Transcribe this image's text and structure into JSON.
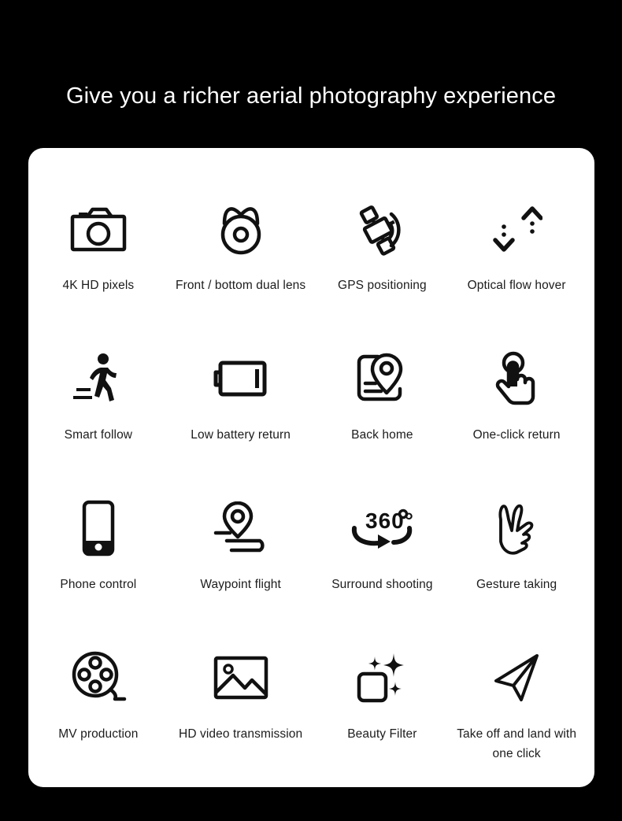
{
  "headline": "Give you a richer aerial photography experience",
  "colors": {
    "background": "#000000",
    "card": "#ffffff",
    "headline_text": "#ffffff",
    "label_text": "#1c1c1c",
    "icon_stroke": "#111111"
  },
  "features": [
    {
      "icon": "camera-icon",
      "label": "4K HD pixels"
    },
    {
      "icon": "dual-lens-icon",
      "label": "Front / bottom dual lens"
    },
    {
      "icon": "gps-satellite-icon",
      "label": "GPS positioning"
    },
    {
      "icon": "up-down-arrows-icon",
      "label": "Optical flow hover"
    },
    {
      "icon": "walking-person-icon",
      "label": "Smart follow"
    },
    {
      "icon": "low-battery-icon",
      "label": "Low battery return"
    },
    {
      "icon": "map-pin-card-icon",
      "label": "Back home"
    },
    {
      "icon": "tap-hand-icon",
      "label": "One-click return"
    },
    {
      "icon": "smartphone-icon",
      "label": "Phone control"
    },
    {
      "icon": "waypoint-path-icon",
      "label": "Waypoint flight"
    },
    {
      "icon": "360-rotation-icon",
      "label": "Surround shooting"
    },
    {
      "icon": "victory-hand-icon",
      "label": "Gesture taking"
    },
    {
      "icon": "film-reel-icon",
      "label": "MV production"
    },
    {
      "icon": "image-frame-icon",
      "label": "HD video transmission"
    },
    {
      "icon": "sparkle-square-icon",
      "label": "Beauty Filter"
    },
    {
      "icon": "paper-plane-icon",
      "label": "Take off and land with one click"
    }
  ],
  "icon_text": {
    "surround_number": "360",
    "surround_degree": "°"
  }
}
